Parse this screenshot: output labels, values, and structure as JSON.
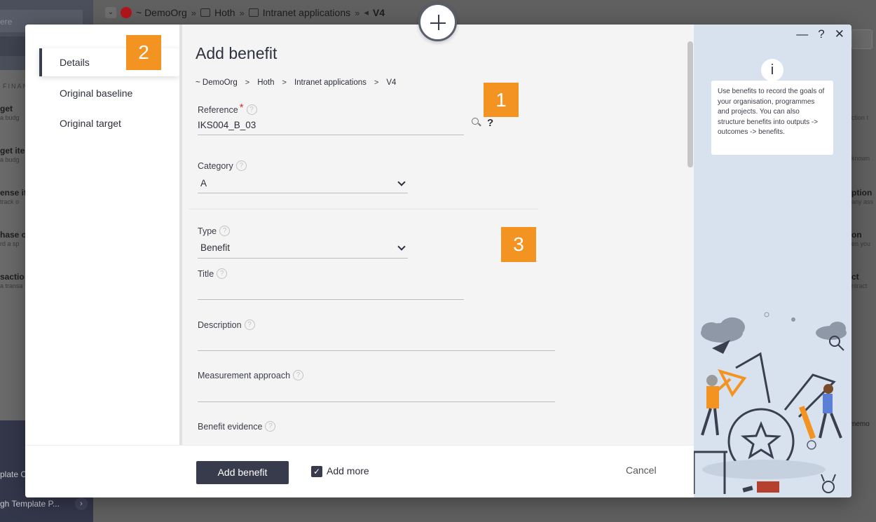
{
  "background": {
    "search_placeholder": "ere",
    "breadcrumb": [
      "~ DemoOrg",
      "Hoth",
      "Intranet applications",
      "V4"
    ],
    "left_section": "FINAN",
    "left_items": [
      {
        "title": "get",
        "sub": "a budg"
      },
      {
        "title": "get ite",
        "sub": "a budg"
      },
      {
        "title": "ense it",
        "sub": "track o"
      },
      {
        "title": "hase o",
        "sub": "rd a sp"
      },
      {
        "title": "sactio",
        "sub": "a transa"
      }
    ],
    "bottom_items": [
      "plate C",
      "gh Template P..."
    ],
    "right_items": [
      {
        "title": "",
        "sub": "ction t"
      },
      {
        "title": "",
        "sub": "known"
      },
      {
        "title": "ption",
        "sub": "any ass"
      },
      {
        "title": "on",
        "sub": "en you"
      },
      {
        "title": "ct",
        "sub": "ntract"
      }
    ],
    "right_memo": "memo"
  },
  "modal": {
    "sidebar": {
      "items": [
        {
          "label": "Details",
          "active": true
        },
        {
          "label": "Original baseline",
          "active": false
        },
        {
          "label": "Original target",
          "active": false
        }
      ]
    },
    "title": "Add benefit",
    "breadcrumb": [
      "~ DemoOrg",
      "Hoth",
      "Intranet applications",
      "V4"
    ],
    "fields": {
      "reference": {
        "label": "Reference",
        "value": "IKS004_B_03",
        "required_mark": "*"
      },
      "category": {
        "label": "Category",
        "value": "A"
      },
      "type": {
        "label": "Type",
        "value": "Benefit"
      },
      "title": {
        "label": "Title",
        "value": ""
      },
      "description": {
        "label": "Description",
        "value": ""
      },
      "measurement_approach": {
        "label": "Measurement approach",
        "value": ""
      },
      "benefit_evidence": {
        "label": "Benefit evidence",
        "value": ""
      }
    },
    "help_glyph": "?",
    "reference_help_button": "?",
    "footer": {
      "primary_button": "Add benefit",
      "add_more_label": "Add more",
      "add_more_checked": true,
      "cancel_label": "Cancel"
    },
    "window_controls": {
      "minimize": "—",
      "help": "?",
      "close": "✕"
    },
    "info_icon": "i",
    "info_text": "Use benefits to record the goals of your organisation, programmes and projects. You can also structure benefits into outputs -> outcomes -> benefits."
  },
  "annotations": {
    "badge_1": "1",
    "badge_2": "2",
    "badge_3": "3"
  },
  "colors": {
    "accent_dark": "#373b4b",
    "badge_orange": "#f39321",
    "required_red": "#d42d2d",
    "panel_blue": "#d8e2ee"
  },
  "icons": [
    "plus-icon",
    "search-icon",
    "info-icon",
    "chevron-down-icon",
    "checkbox-checked-icon",
    "minimize-icon",
    "help-icon",
    "close-icon"
  ]
}
